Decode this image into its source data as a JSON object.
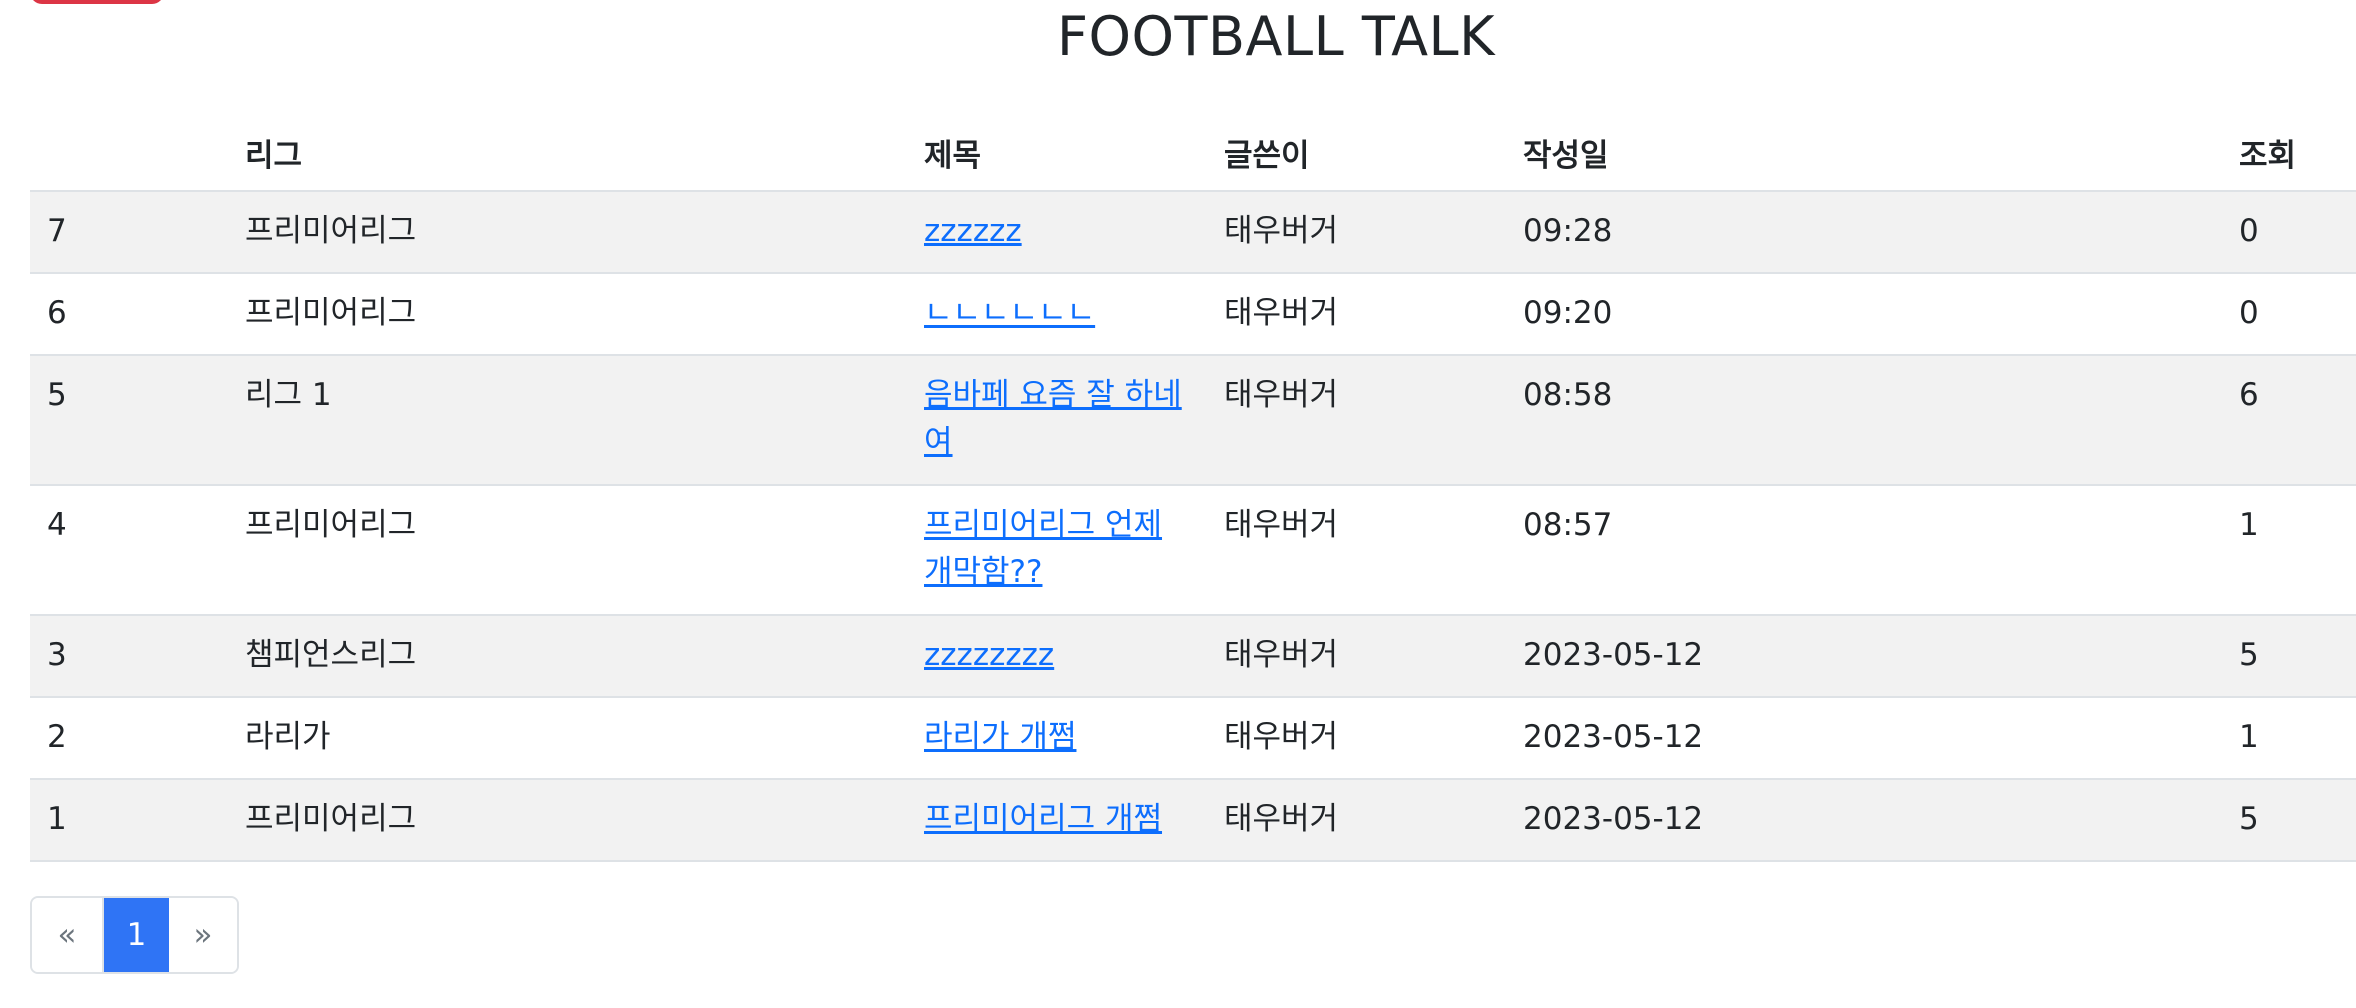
{
  "header": {
    "title": "FOOTBALL TALK"
  },
  "table": {
    "columns": {
      "no": "",
      "league": "리그",
      "title": "제목",
      "writer": "글쓴이",
      "date": "작성일",
      "views": "조회"
    },
    "rows": [
      {
        "no": "7",
        "league": "프리미어리그",
        "title": "zzzzzz",
        "writer": "태우버거",
        "date": "09:28",
        "views": "0"
      },
      {
        "no": "6",
        "league": "프리미어리그",
        "title": "ㄴㄴㄴㄴㄴㄴ",
        "writer": "태우버거",
        "date": "09:20",
        "views": "0"
      },
      {
        "no": "5",
        "league": "리그 1",
        "title": "음바페 요즘 잘 하네여",
        "writer": "태우버거",
        "date": "08:58",
        "views": "6"
      },
      {
        "no": "4",
        "league": "프리미어리그",
        "title": "프리미어리그 언제 개막함??",
        "writer": "태우버거",
        "date": "08:57",
        "views": "1"
      },
      {
        "no": "3",
        "league": "챔피언스리그",
        "title": "zzzzzzzz",
        "writer": "태우버거",
        "date": "2023-05-12",
        "views": "5"
      },
      {
        "no": "2",
        "league": "라리가",
        "title": "라리가 개쩜",
        "writer": "태우버거",
        "date": "2023-05-12",
        "views": "1"
      },
      {
        "no": "1",
        "league": "프리미어리그",
        "title": "프리미어리그 개쩜",
        "writer": "태우버거",
        "date": "2023-05-12",
        "views": "5"
      }
    ]
  },
  "pagination": {
    "prev": "«",
    "current": "1",
    "next": "»"
  },
  "colors": {
    "accent": "#0d6efd",
    "active_page": "#2f74f5",
    "top_button": "#dc3545",
    "stripe": "#f2f2f2"
  }
}
